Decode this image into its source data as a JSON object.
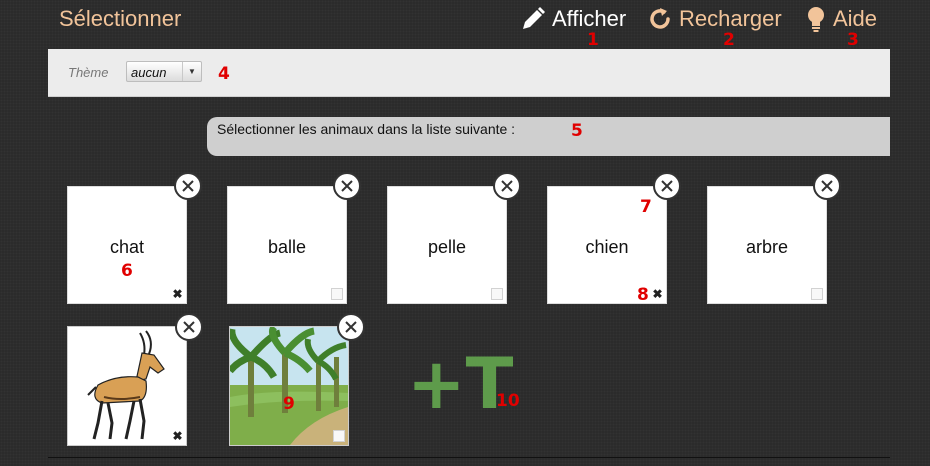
{
  "header": {
    "title": "Sélectionner",
    "buttons": [
      {
        "label": "Afficher",
        "icon": "pencil-icon",
        "color": "#ffffff"
      },
      {
        "label": "Recharger",
        "icon": "refresh-icon",
        "color": "#f2c49a"
      },
      {
        "label": "Aide",
        "icon": "lightbulb-icon",
        "color": "#f2c49a"
      }
    ]
  },
  "theme": {
    "label": "Thème",
    "selected": "aucun"
  },
  "instruction": "Sélectionner les animaux dans la liste suivante :",
  "word_cards": [
    {
      "word": "chat",
      "checked": true
    },
    {
      "word": "balle",
      "checked": false
    },
    {
      "word": "pelle",
      "checked": false
    },
    {
      "word": "chien",
      "checked": true
    },
    {
      "word": "arbre",
      "checked": false
    }
  ],
  "image_cards": [
    {
      "depicts": "gazelle",
      "checked": true
    },
    {
      "depicts": "forest path",
      "checked": false
    }
  ],
  "add_text_button": {
    "label": "+T"
  },
  "markers": [
    "1",
    "2",
    "3",
    "4",
    "5",
    "6",
    "7",
    "8",
    "9",
    "10"
  ],
  "colors": {
    "accent": "#f2c49a",
    "marker": "#e00000",
    "add": "#5e9b4b"
  }
}
